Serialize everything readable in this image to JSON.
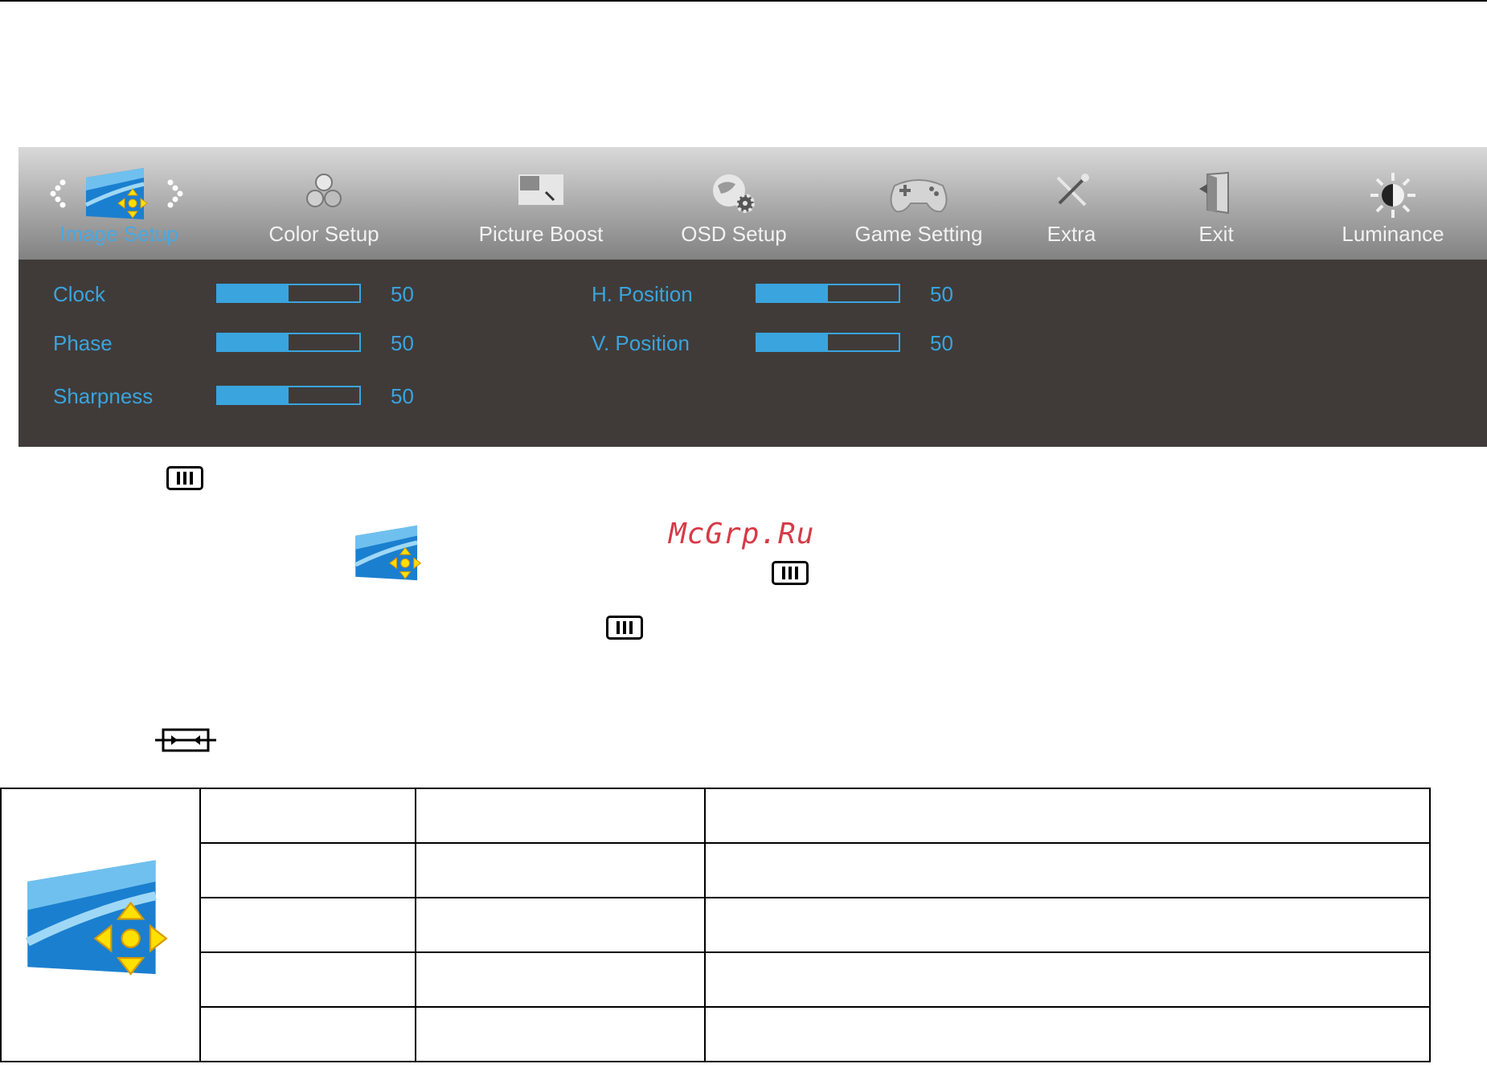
{
  "osd": {
    "tabs": [
      {
        "label": "Image Setup",
        "icon": "image-setup-icon",
        "active": true
      },
      {
        "label": "Color Setup",
        "icon": "color-setup-icon"
      },
      {
        "label": "Picture Boost",
        "icon": "picture-boost-icon"
      },
      {
        "label": "OSD Setup",
        "icon": "osd-setup-icon"
      },
      {
        "label": "Game Setting",
        "icon": "gamepad-icon"
      },
      {
        "label": "Extra",
        "icon": "extra-tools-icon"
      },
      {
        "label": "Exit",
        "icon": "exit-door-icon"
      },
      {
        "label": "Luminance",
        "icon": "sun-icon"
      }
    ],
    "settings": [
      {
        "label": "Clock",
        "value": "50",
        "level": 0.5
      },
      {
        "label": "Phase",
        "value": "50",
        "level": 0.5
      },
      {
        "label": "Sharpness",
        "value": "50",
        "level": 0.5
      },
      {
        "label": "H. Position",
        "value": "50",
        "level": 0.5
      },
      {
        "label": "V. Position",
        "value": "50",
        "level": 0.5
      }
    ]
  },
  "watermark": "McGrp.Ru",
  "icons": {
    "menu_key": "menu-button-icon",
    "auto_key": "auto-adjust-button-icon",
    "section": "image-setup-icon"
  },
  "colors": {
    "accent": "#3aa4de",
    "panel": "#403b39",
    "watermark": "#d63a47"
  }
}
